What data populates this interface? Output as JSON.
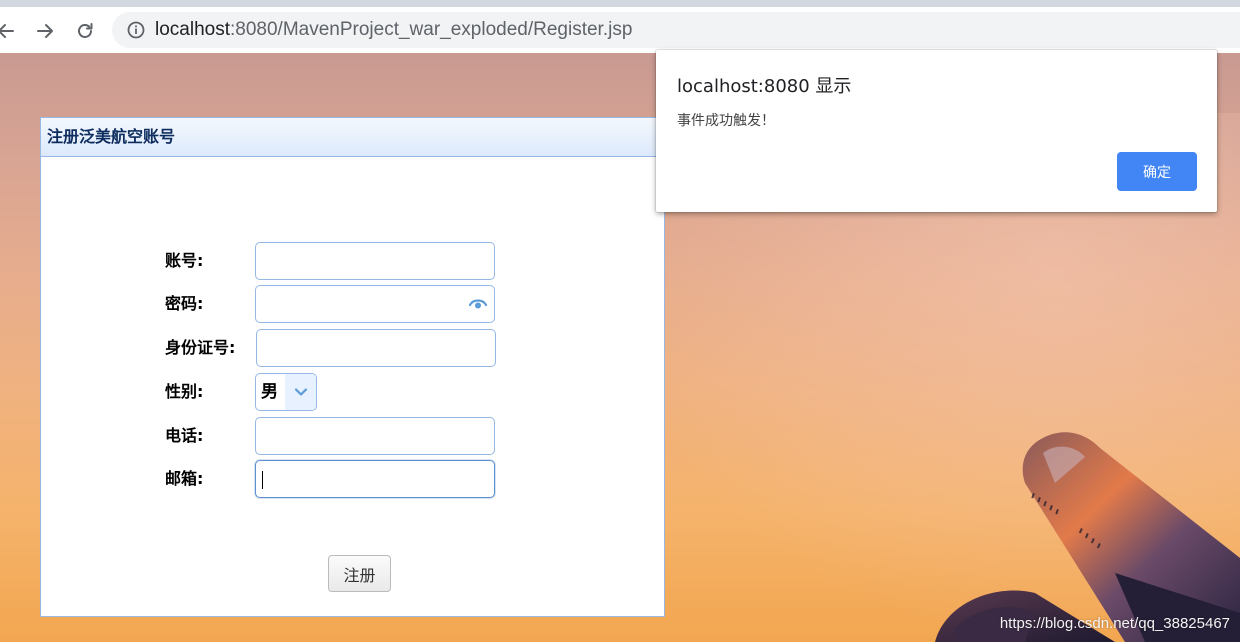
{
  "browser": {
    "url_host": "localhost",
    "url_rest": ":8080/MavenProject_war_exploded/Register.jsp"
  },
  "panel": {
    "title": "注册泛美航空账号"
  },
  "form": {
    "fields": [
      {
        "label": "账号:",
        "value": ""
      },
      {
        "label": "密码:",
        "value": ""
      },
      {
        "label": "身份证号:",
        "value": ""
      },
      {
        "label": "性别:",
        "value": "男"
      },
      {
        "label": "电话:",
        "value": ""
      },
      {
        "label": "邮箱:",
        "value": ""
      }
    ],
    "submit_label": "注册"
  },
  "dialog": {
    "title": "localhost:8080 显示",
    "message": "事件成功触发！",
    "ok_label": "确定"
  },
  "watermark": "https://blog.csdn.net/qq_38825467",
  "colors": {
    "panel_border": "#95b8e7",
    "panel_title": "#0e2d5f",
    "dialog_button": "#4285f4"
  }
}
